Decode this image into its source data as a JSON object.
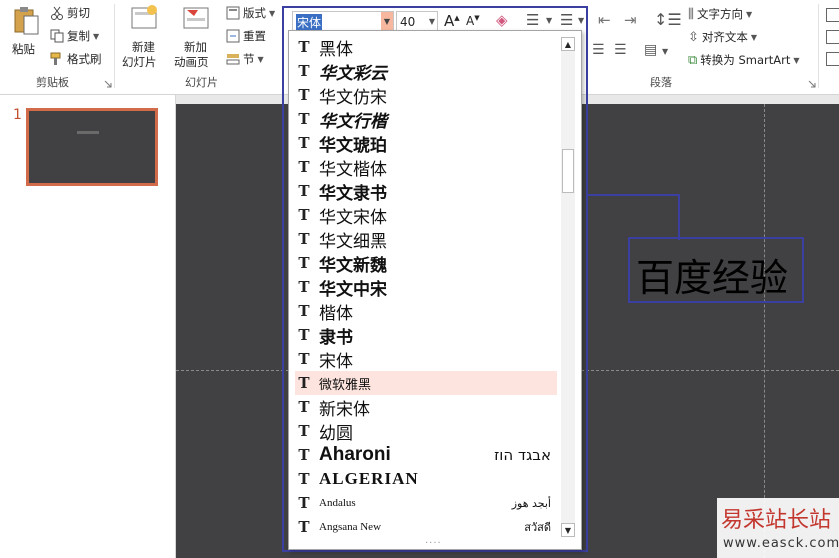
{
  "ribbon": {
    "clipboard": {
      "paste": "粘贴",
      "cut": "剪切",
      "copy": "复制",
      "format_painter": "格式刷",
      "group_label": "剪贴板"
    },
    "slides": {
      "new_slide": "新建\n幻灯片",
      "new_slide_line1": "新建",
      "new_slide_line2": "幻灯片",
      "new_anim_line1": "新加",
      "new_anim_line2": "动画页",
      "layout": "版式",
      "reset": "重置",
      "section": "节",
      "group_label": "幻灯片"
    },
    "font": {
      "name": "宋体",
      "size": "40"
    },
    "paragraph": {
      "text_direction": "文字方向",
      "align_text": "对齐文本",
      "convert_smartart": "转换为 SmartArt",
      "group_label": "段落"
    }
  },
  "thumbnails": [
    {
      "number": "1"
    }
  ],
  "slide": {
    "text_box": "百度经验"
  },
  "font_list": [
    {
      "name": "黑体",
      "sample": ""
    },
    {
      "name": "华文彩云",
      "sample": ""
    },
    {
      "name": "华文仿宋",
      "sample": ""
    },
    {
      "name": "华文行楷",
      "sample": ""
    },
    {
      "name": "华文琥珀",
      "sample": ""
    },
    {
      "name": "华文楷体",
      "sample": ""
    },
    {
      "name": "华文隶书",
      "sample": ""
    },
    {
      "name": "华文宋体",
      "sample": ""
    },
    {
      "name": "华文细黑",
      "sample": ""
    },
    {
      "name": "华文新魏",
      "sample": ""
    },
    {
      "name": "华文中宋",
      "sample": ""
    },
    {
      "name": "楷体",
      "sample": ""
    },
    {
      "name": "隶书",
      "sample": ""
    },
    {
      "name": "宋体",
      "sample": ""
    },
    {
      "name": "微软雅黑",
      "sample": "",
      "selected": true
    },
    {
      "name": "新宋体",
      "sample": ""
    },
    {
      "name": "幼圆",
      "sample": ""
    },
    {
      "name": "Aharoni",
      "sample": "אבגד הוז"
    },
    {
      "name": "ALGERIAN",
      "sample": ""
    },
    {
      "name": "Andalus",
      "sample": "أبجد هوز"
    },
    {
      "name": "Angsana New",
      "sample": "สวัสดี"
    }
  ],
  "watermark": {
    "text": "易采站长站",
    "url": "www.easck.com"
  },
  "colors": {
    "slide_bg": "#414042",
    "selection": "#fde4de",
    "thumb_border": "#d26b4a",
    "highlight_box": "#3b3fa0"
  }
}
